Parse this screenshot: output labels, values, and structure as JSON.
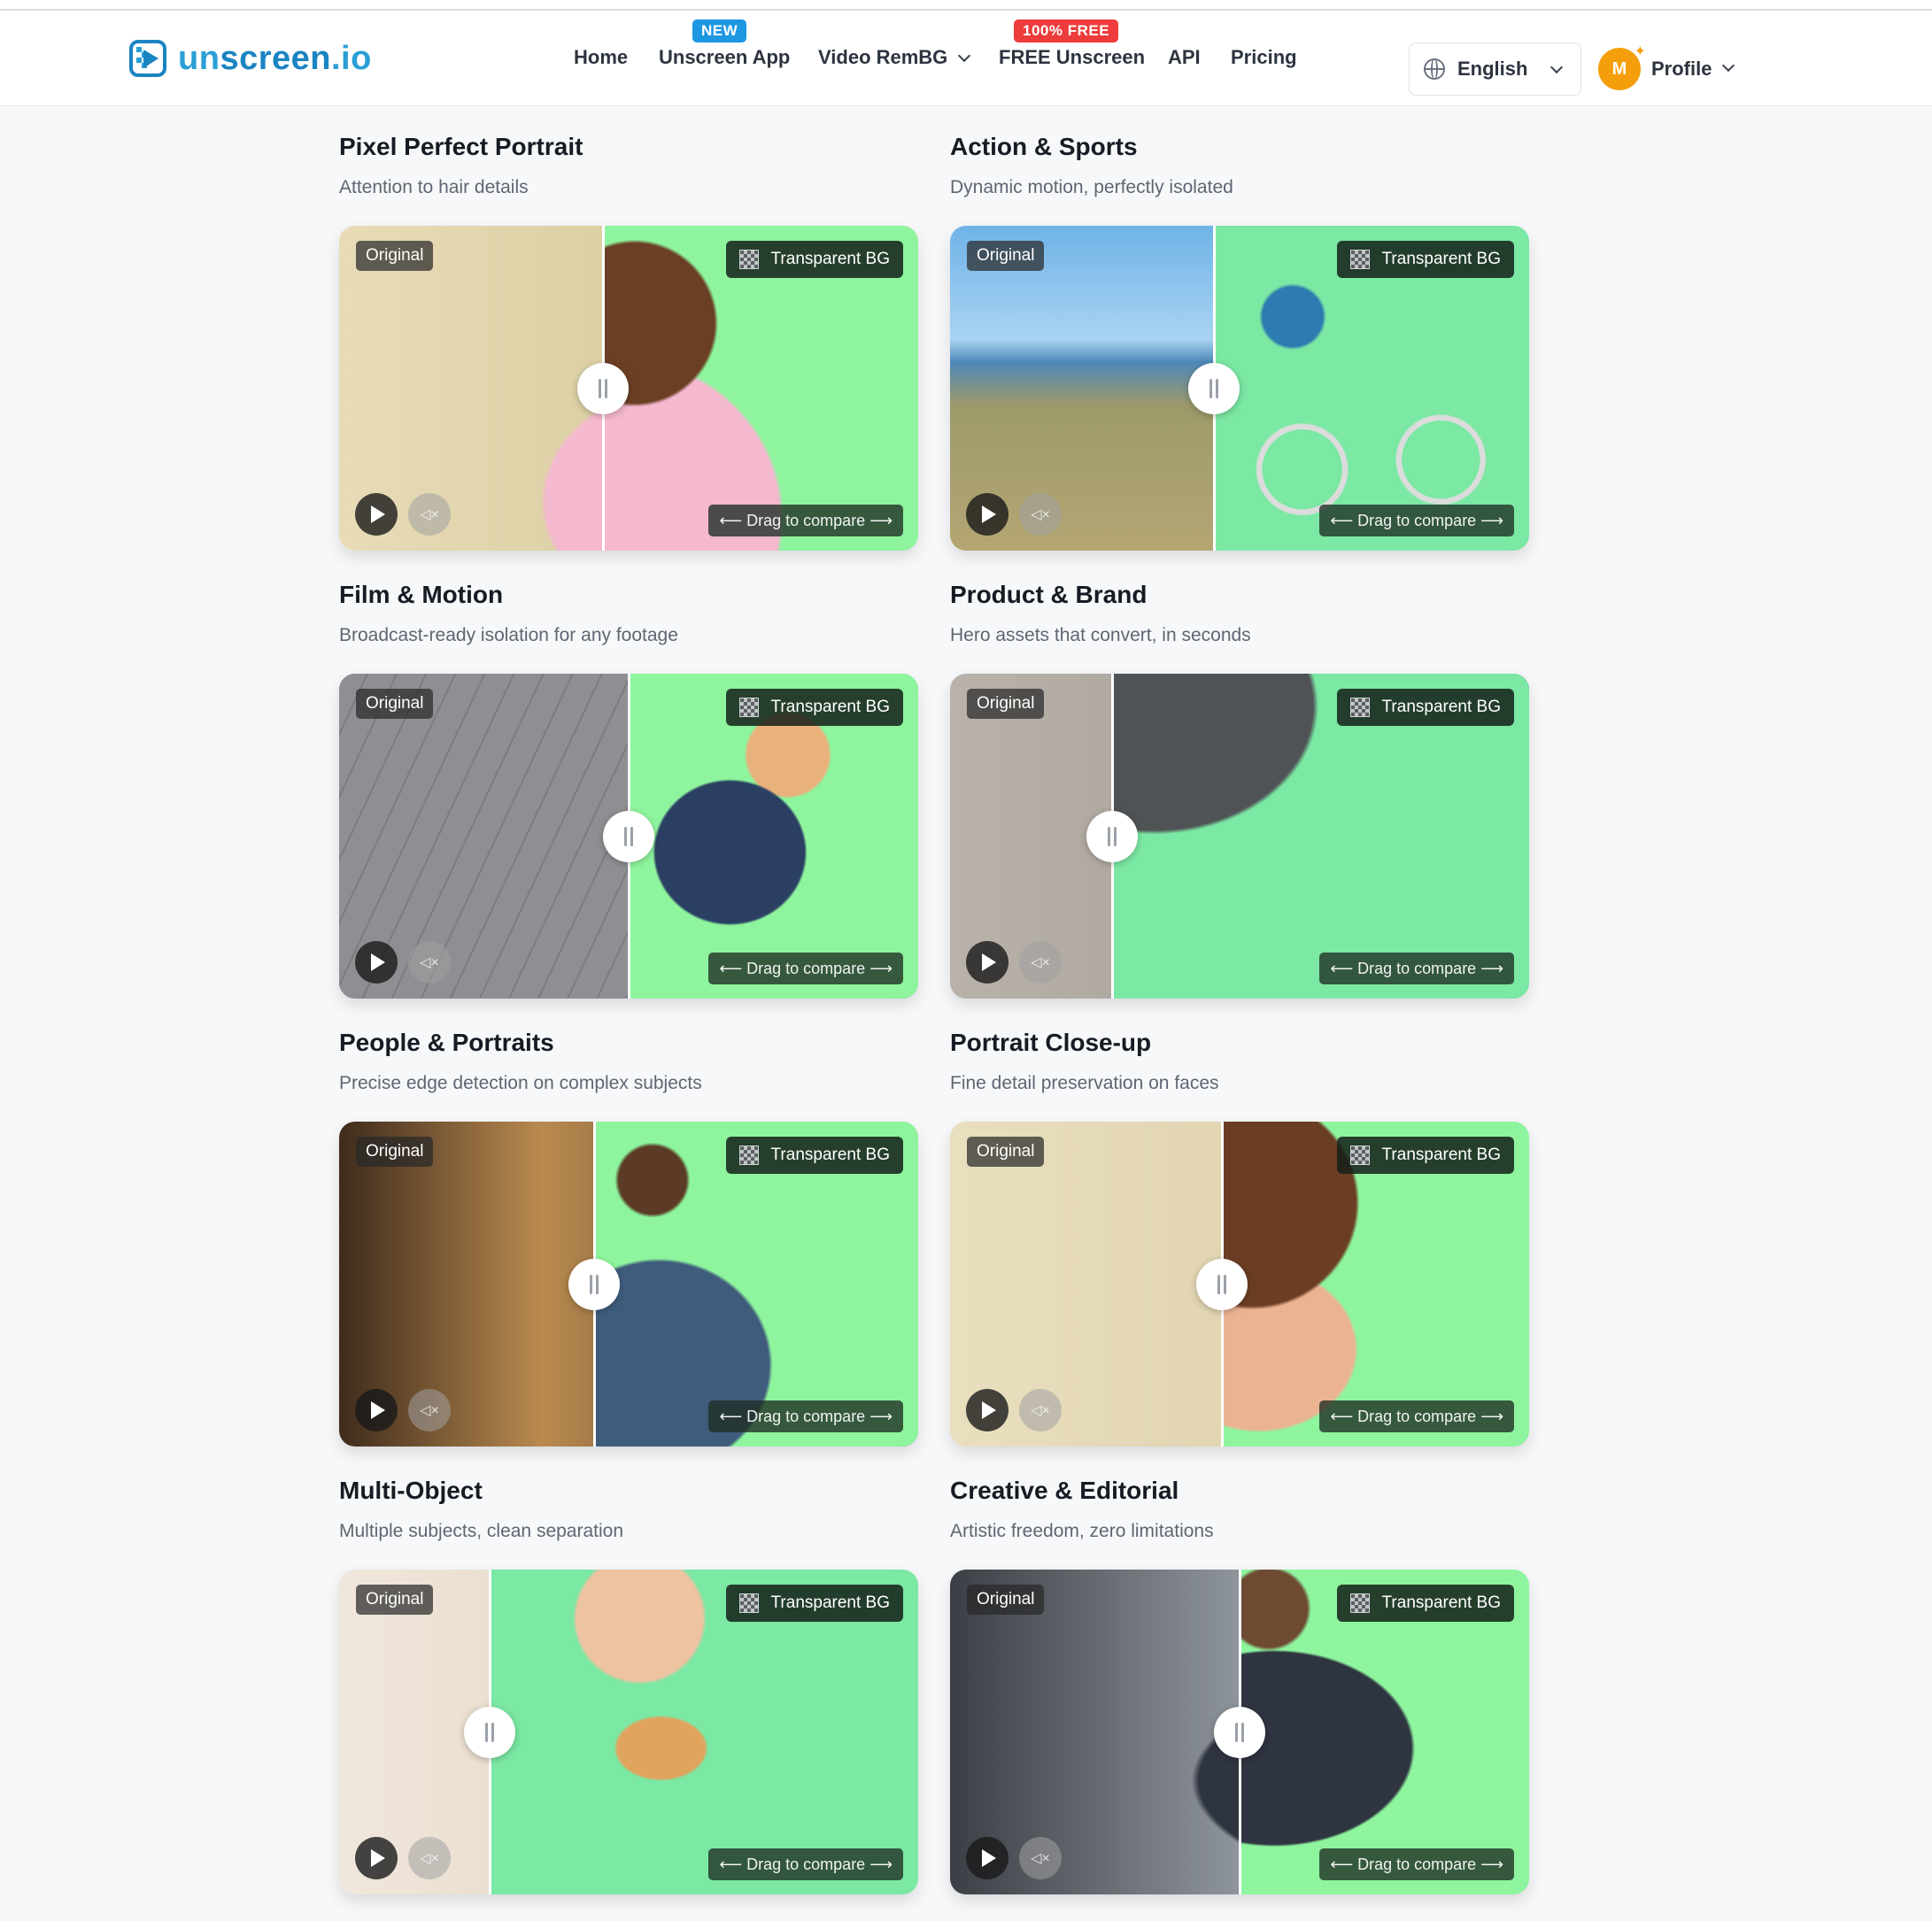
{
  "brand": {
    "name_part1": "un",
    "name_part2": "screen",
    "name_part3": ".io"
  },
  "nav": {
    "home": "Home",
    "app": "Unscreen App",
    "app_badge": "NEW",
    "remgb": "Video RemBG",
    "free": "FREE Unscreen",
    "free_badge": "100% FREE",
    "api": "API",
    "pricing": "Pricing"
  },
  "language": {
    "label": "English"
  },
  "profile": {
    "initial": "M",
    "label": "Profile"
  },
  "labels": {
    "original": "Original",
    "transparent": "Transparent BG",
    "drag": "⟵ Drag to compare ⟶"
  },
  "colors": {
    "accent": "#2a9fd6",
    "green_screen": "#8ef59e",
    "new_badge": "#1e97e3",
    "free_badge": "#ee3b3b"
  },
  "cards": [
    {
      "title": "Pixel Perfect Portrait",
      "subtitle": "Attention to hair details",
      "split": 0.455,
      "green": "#8ef59e"
    },
    {
      "title": "Action & Sports",
      "subtitle": "Dynamic motion, perfectly isolated",
      "split": 0.455,
      "green": "#7be8a4"
    },
    {
      "title": "Film & Motion",
      "subtitle": "Broadcast-ready isolation for any footage",
      "split": 0.5,
      "green": "#8ef59e"
    },
    {
      "title": "Product & Brand",
      "subtitle": "Hero assets that convert, in seconds",
      "split": 0.28,
      "green": "#7be8a4"
    },
    {
      "title": "People & Portraits",
      "subtitle": "Precise edge detection on complex subjects",
      "split": 0.44,
      "green": "#8ef59e"
    },
    {
      "title": "Portrait Close-up",
      "subtitle": "Fine detail preservation on faces",
      "split": 0.47,
      "green": "#8ef59e"
    },
    {
      "title": "Multi-Object",
      "subtitle": "Multiple subjects, clean separation",
      "split": 0.26,
      "green": "#7be8a4"
    },
    {
      "title": "Creative & Editorial",
      "subtitle": "Artistic freedom, zero limitations",
      "split": 0.5,
      "green": "#8ef59e"
    }
  ]
}
